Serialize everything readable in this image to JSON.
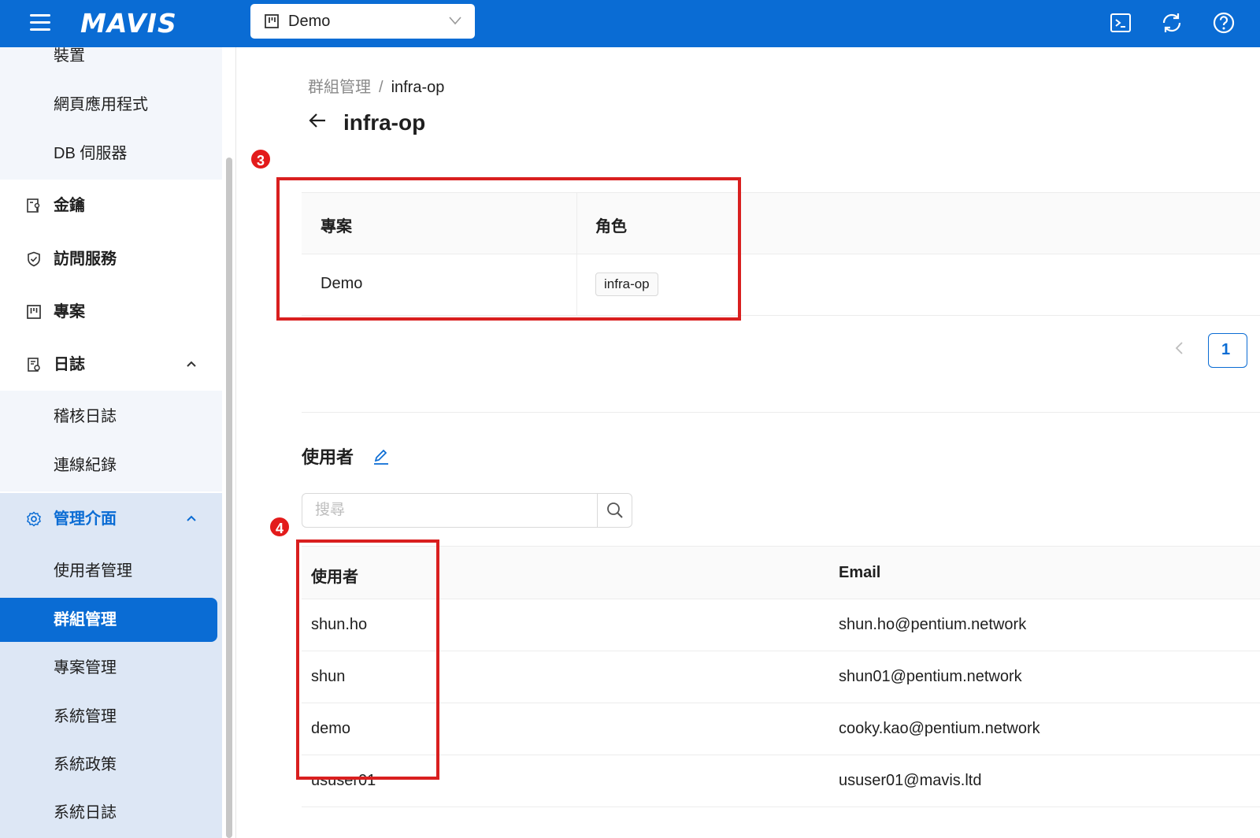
{
  "app": {
    "logo_text": "MAVIS",
    "accent_color": "#0a6cd4"
  },
  "topbar": {
    "project_selector_value": "Demo",
    "icons": [
      "terminal-icon",
      "refresh-icon",
      "help-icon"
    ]
  },
  "sidebar": {
    "items": [
      {
        "label": "裝置"
      },
      {
        "label": "網頁應用程式"
      },
      {
        "label": "DB 伺服器"
      },
      {
        "label": "金鑰"
      },
      {
        "label": "訪問服務"
      },
      {
        "label": "專案"
      },
      {
        "label": "日誌"
      },
      {
        "label": "稽核日誌"
      },
      {
        "label": "連線紀錄"
      },
      {
        "label": "管理介面"
      },
      {
        "label": "使用者管理"
      },
      {
        "label": "群組管理"
      },
      {
        "label": "專案管理"
      },
      {
        "label": "系統管理"
      },
      {
        "label": "系統政策"
      },
      {
        "label": "系統日誌"
      }
    ]
  },
  "breadcrumb": {
    "parent": "群組管理",
    "separator": "/",
    "current": "infra-op"
  },
  "page_title": "infra-op",
  "annotations": {
    "badge_3": "3",
    "badge_4": "4",
    "color": "#d91f1f"
  },
  "projects_table": {
    "headers": {
      "project": "專案",
      "role": "角色"
    },
    "rows": [
      {
        "project": "Demo",
        "role": "infra-op"
      }
    ]
  },
  "pagination": {
    "current_page": "1"
  },
  "users_section": {
    "title": "使用者",
    "search_placeholder": "搜尋",
    "headers": {
      "user": "使用者",
      "email": "Email"
    },
    "rows": [
      {
        "user": "shun.ho",
        "email": "shun.ho@pentium.network"
      },
      {
        "user": "shun",
        "email": "shun01@pentium.network"
      },
      {
        "user": "demo",
        "email": "cooky.kao@pentium.network"
      },
      {
        "user": "ususer01",
        "email": "ususer01@mavis.ltd"
      }
    ]
  }
}
